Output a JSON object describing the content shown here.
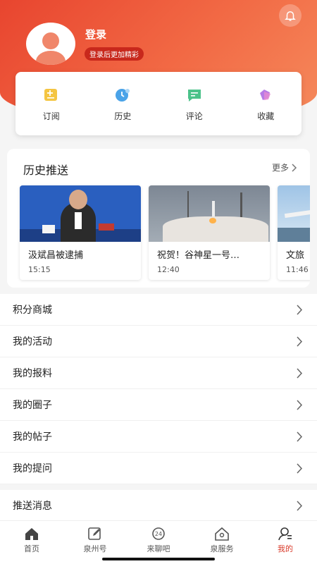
{
  "profile": {
    "login_title": "登录",
    "login_badge": "登录后更加精彩"
  },
  "quick_actions": [
    {
      "label": "订阅",
      "icon": "subscribe-icon"
    },
    {
      "label": "历史",
      "icon": "history-icon"
    },
    {
      "label": "评论",
      "icon": "comment-icon"
    },
    {
      "label": "收藏",
      "icon": "favorite-icon"
    }
  ],
  "history": {
    "title": "历史推送",
    "more_label": "更多",
    "items": [
      {
        "title": "汲斌昌被逮捕",
        "time": "15:15",
        "image": "press-conference-photo"
      },
      {
        "title": "祝贺！谷神星一号…",
        "time": "12:40",
        "image": "rocket-launch-photo"
      },
      {
        "title": "文旅",
        "time": "11:46",
        "image": "aircraft-photo"
      }
    ]
  },
  "menu": {
    "items": [
      "积分商城",
      "我的活动",
      "我的报料",
      "我的圈子",
      "我的帖子",
      "我的提问"
    ],
    "push_label": "推送消息"
  },
  "tabbar": {
    "tabs": [
      {
        "label": "首页",
        "icon": "home-icon"
      },
      {
        "label": "泉州号",
        "icon": "edit-icon"
      },
      {
        "label": "来聊吧",
        "icon": "chat-24-icon"
      },
      {
        "label": "泉服务",
        "icon": "service-icon"
      },
      {
        "label": "我的",
        "icon": "profile-icon"
      }
    ],
    "active": "我的"
  },
  "colors": {
    "brand": "#e8452f",
    "active_tab": "#d93a2a"
  }
}
